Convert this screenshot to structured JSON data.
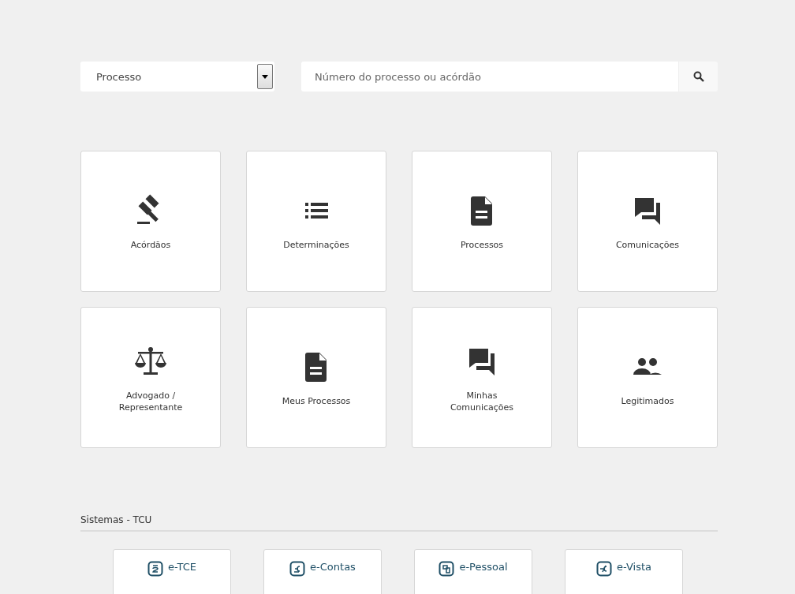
{
  "search": {
    "select_value": "Processo",
    "placeholder": "Número do processo ou acórdão"
  },
  "tiles": [
    {
      "kind": "gavel",
      "label": "Acórdãos"
    },
    {
      "kind": "list",
      "label": "Determinações"
    },
    {
      "kind": "document",
      "label": "Processos"
    },
    {
      "kind": "chat",
      "label": "Comunicações"
    },
    {
      "kind": "scale",
      "label": "Advogado / Representante"
    },
    {
      "kind": "document",
      "label": "Meus Processos"
    },
    {
      "kind": "chat",
      "label": "Minhas Comunicações"
    },
    {
      "kind": "people",
      "label": "Legitimados"
    }
  ],
  "systems": {
    "title": "Sistemas - TCU",
    "items": [
      {
        "kind": "tce",
        "label": "e-TCE"
      },
      {
        "kind": "contas",
        "label": "e-Contas"
      },
      {
        "kind": "pessoal",
        "label": "e-Pessoal"
      },
      {
        "kind": "vista",
        "label": "e-Vista"
      }
    ]
  }
}
